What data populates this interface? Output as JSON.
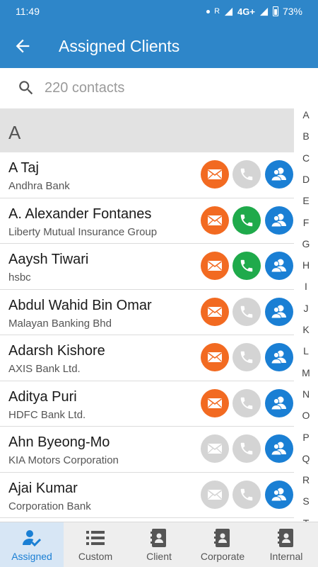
{
  "status": {
    "time": "11:49",
    "carrier": "R",
    "network": "4G+",
    "battery": "73%"
  },
  "appbar": {
    "title": "Assigned Clients",
    "back_icon": "arrow-left-icon"
  },
  "search": {
    "placeholder": "220 contacts"
  },
  "section": {
    "letter": "A"
  },
  "colors": {
    "primary": "#2e86c9",
    "mail": "#f26a21",
    "call": "#1faa4b",
    "people": "#1a7fd4",
    "disabled": "#d4d4d4"
  },
  "contacts": [
    {
      "name": "A Taj",
      "company": "Andhra Bank",
      "mail": true,
      "call": false,
      "people": true
    },
    {
      "name": "A. Alexander Fontanes",
      "company": "Liberty Mutual Insurance Group",
      "mail": true,
      "call": true,
      "people": true
    },
    {
      "name": "Aaysh Tiwari",
      "company": "hsbc",
      "mail": true,
      "call": true,
      "people": true
    },
    {
      "name": "Abdul Wahid Bin Omar",
      "company": "Malayan Banking Bhd",
      "mail": true,
      "call": false,
      "people": true
    },
    {
      "name": "Adarsh Kishore",
      "company": "AXIS Bank Ltd.",
      "mail": true,
      "call": false,
      "people": true
    },
    {
      "name": "Aditya Puri",
      "company": "HDFC Bank Ltd.",
      "mail": true,
      "call": false,
      "people": true
    },
    {
      "name": "Ahn Byeong-Mo",
      "company": "KIA Motors Corporation",
      "mail": false,
      "call": false,
      "people": true
    },
    {
      "name": "Ajai Kumar",
      "company": "Corporation Bank",
      "mail": false,
      "call": false,
      "people": true
    }
  ],
  "index_letters": [
    "A",
    "B",
    "C",
    "D",
    "E",
    "F",
    "G",
    "H",
    "I",
    "J",
    "K",
    "L",
    "M",
    "N",
    "O",
    "P",
    "Q",
    "R",
    "S",
    "T"
  ],
  "bottom_nav": [
    {
      "label": "Assigned",
      "icon": "person-check-icon",
      "active": true
    },
    {
      "label": "Custom",
      "icon": "list-icon",
      "active": false
    },
    {
      "label": "Client",
      "icon": "contact-book-icon",
      "active": false
    },
    {
      "label": "Corporate",
      "icon": "contact-book-icon",
      "active": false
    },
    {
      "label": "Internal",
      "icon": "contact-book-icon",
      "active": false
    }
  ]
}
